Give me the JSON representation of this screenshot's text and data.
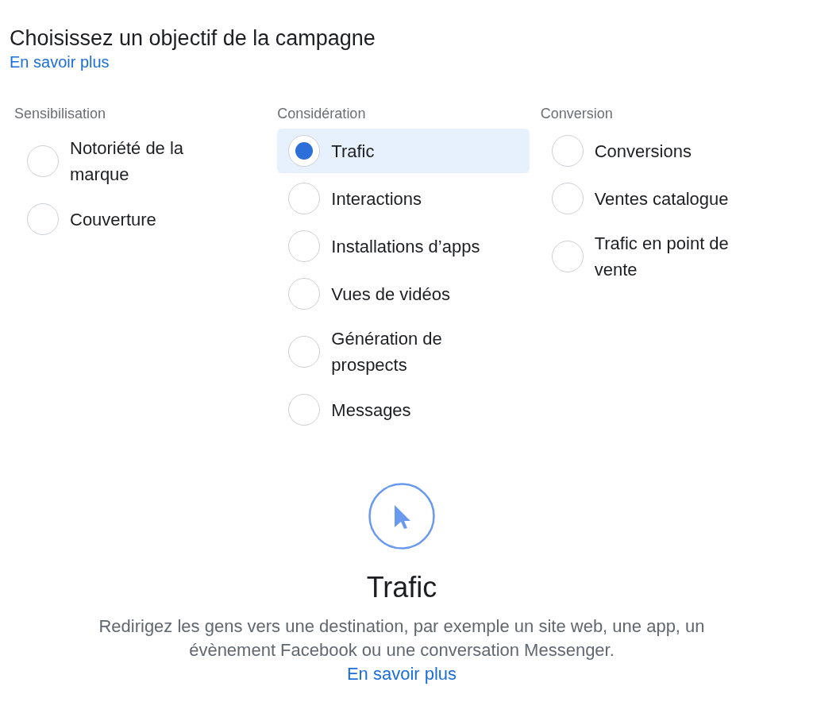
{
  "header": {
    "title": "Choisissez un objectif de la campagne",
    "link": "En savoir plus"
  },
  "groups": [
    {
      "heading": "Sensibilisation",
      "options": [
        {
          "label": "Notoriété de la marque",
          "selected": false
        },
        {
          "label": "Couverture",
          "selected": false
        }
      ]
    },
    {
      "heading": "Considération",
      "options": [
        {
          "label": "Trafic",
          "selected": true
        },
        {
          "label": "Interactions",
          "selected": false
        },
        {
          "label": "Installations d’apps",
          "selected": false
        },
        {
          "label": "Vues de vidéos",
          "selected": false
        },
        {
          "label": "Génération de prospects",
          "selected": false
        },
        {
          "label": "Messages",
          "selected": false
        }
      ]
    },
    {
      "heading": "Conversion",
      "options": [
        {
          "label": "Conversions",
          "selected": false
        },
        {
          "label": "Ventes catalogue",
          "selected": false
        },
        {
          "label": "Trafic en point de vente",
          "selected": false
        }
      ]
    }
  ],
  "detail": {
    "title": "Trafic",
    "description": "Redirigez les gens vers une destination, par exemple un site web, une app, un évènement Facebook ou une conversation Messenger.",
    "link": "En savoir plus"
  }
}
